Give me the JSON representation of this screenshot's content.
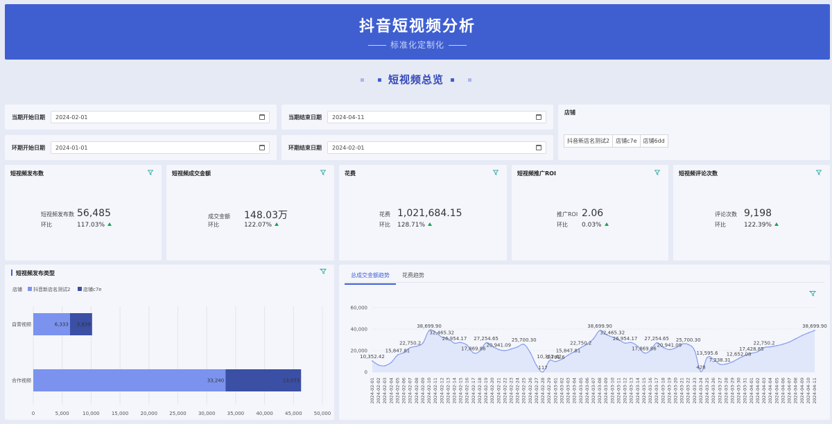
{
  "header": {
    "title": "抖音短视频分析",
    "subtitle": "标准化定制化"
  },
  "section": {
    "title": "短视频总览"
  },
  "filters": {
    "cur_start_label": "当期开始日期",
    "cur_start_value": "2024-02-01",
    "cur_end_label": "当期结束日期",
    "cur_end_value": "2024-04-11",
    "prev_start_label": "环期开始日期",
    "prev_start_value": "2024-01-01",
    "prev_end_label": "环期结束日期",
    "prev_end_value": "2024-02-01"
  },
  "store": {
    "title": "店铺",
    "tags": [
      "抖音新店名测试2",
      "店铺c7e",
      "店铺6dd"
    ]
  },
  "kpis": [
    {
      "title": "短视频发布数",
      "label": "短视频发布数",
      "value": "56,485",
      "ratio_label": "环比",
      "ratio": "117.03%"
    },
    {
      "title": "短视频成交金额",
      "label": "成交金额",
      "value": "148.03万",
      "ratio_label": "环比",
      "ratio": "122.07%"
    },
    {
      "title": "花费",
      "label": "花费",
      "value": "1,021,684.15",
      "ratio_label": "环比",
      "ratio": "128.71%"
    },
    {
      "title": "短视频推广ROI",
      "label": "推广ROI",
      "value": "2.06",
      "ratio_label": "环比",
      "ratio": "0.03%"
    },
    {
      "title": "短视频评论次数",
      "label": "评论次数",
      "value": "9,198",
      "ratio_label": "环比",
      "ratio": "122.39%"
    }
  ],
  "colors": {
    "primary": "#3f5fd1",
    "bar_series1": "#7b93ee",
    "bar_series2": "#3b4fa5",
    "up": "#1aa35a",
    "icon_teal": "#2aa7a0",
    "line": "#8aa2ea",
    "area": "#dfe6fb"
  },
  "bar_panel": {
    "title": "短视频发布类型"
  },
  "trend_panel": {
    "tabs": [
      "总成交金额趋势",
      "花费趋势"
    ],
    "active_tab": 0
  },
  "chart_data": [
    {
      "type": "bar",
      "orientation": "horizontal",
      "stacked": true,
      "legend_title": "店铺",
      "legend_position": "top-left",
      "categories": [
        "自营视频",
        "合作视频"
      ],
      "series": [
        {
          "name": "抖音新店名测试2",
          "values": [
            6333,
            33240
          ],
          "labels": [
            "6,333",
            "33,240"
          ]
        },
        {
          "name": "店铺c7e",
          "values": [
            3839,
            13073
          ],
          "labels": [
            "3,839",
            "13,073"
          ]
        }
      ],
      "xlim": [
        0,
        50000
      ],
      "xticks": [
        "0",
        "5,000",
        "10,000",
        "15,000",
        "20,000",
        "25,000",
        "30,000",
        "35,000",
        "40,000",
        "45,000",
        "50,000"
      ],
      "grid": true
    },
    {
      "type": "area",
      "ylim": [
        0,
        60000
      ],
      "yticks": [
        "0",
        "20,000",
        "40,000",
        "60,000"
      ],
      "x": [
        "2024-02-01",
        "2024-02-02",
        "2024-02-03",
        "2024-02-04",
        "2024-02-05",
        "2024-02-06",
        "2024-02-07",
        "2024-02-08",
        "2024-02-09",
        "2024-02-10",
        "2024-02-11",
        "2024-02-12",
        "2024-02-13",
        "2024-02-14",
        "2024-02-15",
        "2024-02-16",
        "2024-02-17",
        "2024-02-18",
        "2024-02-19",
        "2024-02-20",
        "2024-02-21",
        "2024-02-22",
        "2024-02-23",
        "2024-02-24",
        "2024-02-25",
        "2024-02-26",
        "2024-02-27",
        "2024-02-28",
        "2024-02-29",
        "2024-03-01",
        "2024-03-02",
        "2024-03-03",
        "2024-03-04",
        "2024-03-05",
        "2024-03-06",
        "2024-03-07",
        "2024-03-08",
        "2024-03-09",
        "2024-03-10",
        "2024-03-11",
        "2024-03-12",
        "2024-03-13",
        "2024-03-14",
        "2024-03-15",
        "2024-03-16",
        "2024-03-17",
        "2024-03-18",
        "2024-03-19",
        "2024-03-20",
        "2024-03-21",
        "2024-03-22",
        "2024-03-23",
        "2024-03-24",
        "2024-03-25",
        "2024-03-26",
        "2024-03-27",
        "2024-03-28",
        "2024-03-29",
        "2024-03-30",
        "2024-03-31",
        "2024-04-01",
        "2024-04-02",
        "2024-04-03",
        "2024-04-04",
        "2024-04-05",
        "2024-04-06",
        "2024-04-07",
        "2024-04-08",
        "2024-04-09",
        "2024-04-10",
        "2024-04-11"
      ],
      "values": [
        10352.42,
        6500,
        5900,
        9000,
        15847.81,
        18000,
        22750.2,
        24000,
        27000,
        38699.9,
        37000,
        32465.32,
        31000,
        26954.17,
        27500,
        25000,
        17869.86,
        19500,
        27254.65,
        24000,
        20941.09,
        20000,
        21500,
        23500,
        25700.3,
        18000,
        6000,
        117,
        10352.42,
        9791.6,
        12000,
        15847.81,
        19000,
        22750.2,
        26000,
        31000,
        38699.9,
        35000,
        32465.32,
        30000,
        26954.17,
        27500,
        24000,
        17869.86,
        20000,
        27254.65,
        23000,
        20941.09,
        22500,
        26000,
        25700.3,
        20000,
        428,
        13595.6,
        12000,
        7238.31,
        7500,
        9500,
        12652.08,
        15500,
        17428.85,
        19000,
        22750.2,
        23500,
        24500,
        26000,
        28000,
        31000,
        34000,
        36500,
        38699.9
      ],
      "value_labels": {
        "0": "10,352.42",
        "4": "15,847.81",
        "6": "22,750.2",
        "9": "38,699.90",
        "11": "32,465.32",
        "13": "26,954.17",
        "16": "17,869.86",
        "18": "27,254.65",
        "20": "20,941.09",
        "24": "25,700.30",
        "27": "117",
        "28": "10,352.42",
        "29": "9,791.6",
        "31": "15,847.81",
        "33": "22,750.2",
        "36": "38,699.90",
        "38": "32,465.32",
        "40": "26,954.17",
        "43": "17,869.86",
        "45": "27,254.65",
        "47": "20,941.09",
        "50": "25,700.30",
        "52": "428",
        "53": "13,595.6",
        "55": "7,238.31",
        "58": "12,652.08",
        "60": "17,428.85",
        "62": "22,750.2",
        "70": "38,699.90"
      }
    }
  ]
}
